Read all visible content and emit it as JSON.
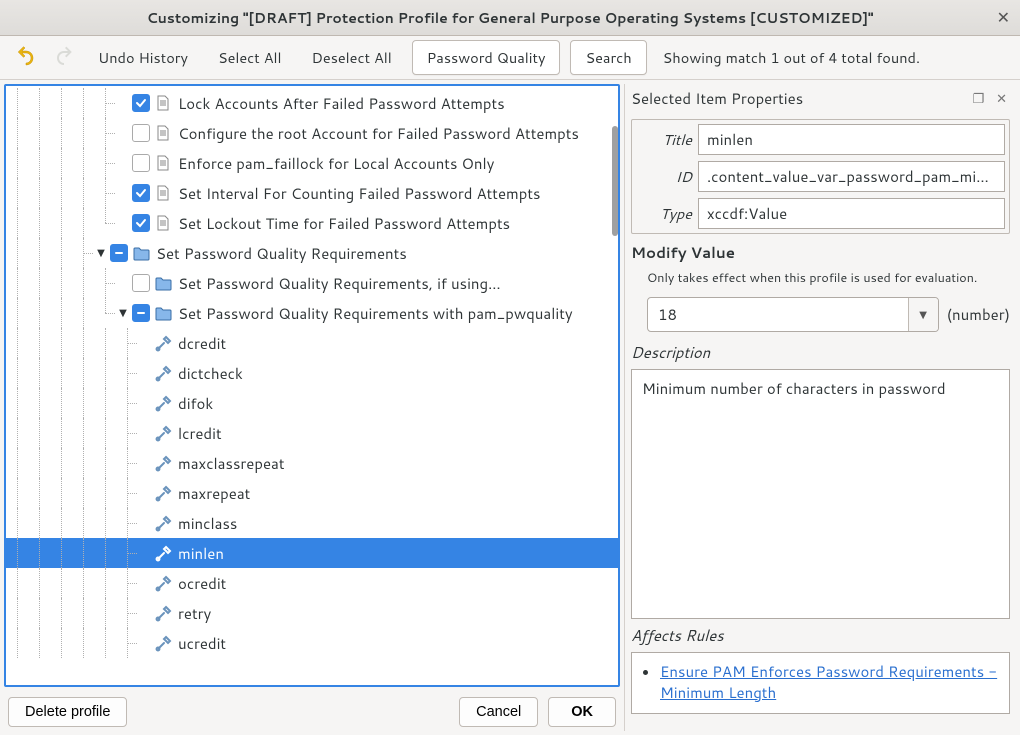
{
  "window": {
    "title": "Customizing \"[DRAFT] Protection Profile for General Purpose Operating Systems [CUSTOMIZED]\""
  },
  "toolbar": {
    "undo_history": "Undo History",
    "select_all": "Select All",
    "deselect_all": "Deselect All",
    "search_value": "Password Quality",
    "search_btn": "Search",
    "match_status": "Showing match 1 out of 4 total found."
  },
  "tree": {
    "rows": [
      {
        "indent": 5,
        "checked": true,
        "icon": "doc",
        "label": "Lock Accounts After Failed Password Attempts"
      },
      {
        "indent": 5,
        "checked": false,
        "icon": "doc",
        "label": "Configure the root Account for Failed Password Attempts"
      },
      {
        "indent": 5,
        "checked": false,
        "icon": "doc",
        "label": "Enforce pam_faillock for Local Accounts Only"
      },
      {
        "indent": 5,
        "checked": true,
        "icon": "doc",
        "label": "Set Interval For Counting Failed Password Attempts"
      },
      {
        "indent": 5,
        "checked": true,
        "icon": "doc",
        "label": "Set Lockout Time for Failed Password Attempts",
        "last": true
      },
      {
        "indent": 4,
        "expander": "down",
        "checked": "partial",
        "icon": "folder",
        "label": "Set Password Quality Requirements"
      },
      {
        "indent": 5,
        "checked": false,
        "icon": "folder",
        "label": "Set Password Quality Requirements, if using…"
      },
      {
        "indent": 5,
        "expander": "down",
        "checked": "partial",
        "icon": "folder",
        "label": "Set Password Quality Requirements with pam_pwquality",
        "last": true
      },
      {
        "indent": 6,
        "icon": "tool",
        "label": "dcredit"
      },
      {
        "indent": 6,
        "icon": "tool",
        "label": "dictcheck"
      },
      {
        "indent": 6,
        "icon": "tool",
        "label": "difok"
      },
      {
        "indent": 6,
        "icon": "tool",
        "label": "lcredit"
      },
      {
        "indent": 6,
        "icon": "tool",
        "label": "maxclassrepeat"
      },
      {
        "indent": 6,
        "icon": "tool",
        "label": "maxrepeat"
      },
      {
        "indent": 6,
        "icon": "tool",
        "label": "minclass"
      },
      {
        "indent": 6,
        "icon": "tool",
        "label": "minlen",
        "selected": true
      },
      {
        "indent": 6,
        "icon": "tool",
        "label": "ocredit"
      },
      {
        "indent": 6,
        "icon": "tool",
        "label": "retry"
      },
      {
        "indent": 6,
        "icon": "tool",
        "label": "ucredit"
      }
    ]
  },
  "buttons": {
    "delete_profile": "Delete profile",
    "cancel": "Cancel",
    "ok": "OK"
  },
  "props": {
    "header": "Selected Item Properties",
    "keys": {
      "title": "Title",
      "id": "ID",
      "type": "Type"
    },
    "title": "minlen",
    "id": ".content_value_var_password_pam_minlen",
    "type": "xccdf:Value",
    "modify_label": "Modify Value",
    "modify_hint": "Only takes effect when this profile is used for evaluation.",
    "value": "18",
    "unit": "(number)",
    "desc_label": "Description",
    "description": "Minimum number of characters in password",
    "affects_label": "Affects Rules",
    "rules": [
      "Ensure PAM Enforces Password Requirements - Minimum Length"
    ]
  }
}
